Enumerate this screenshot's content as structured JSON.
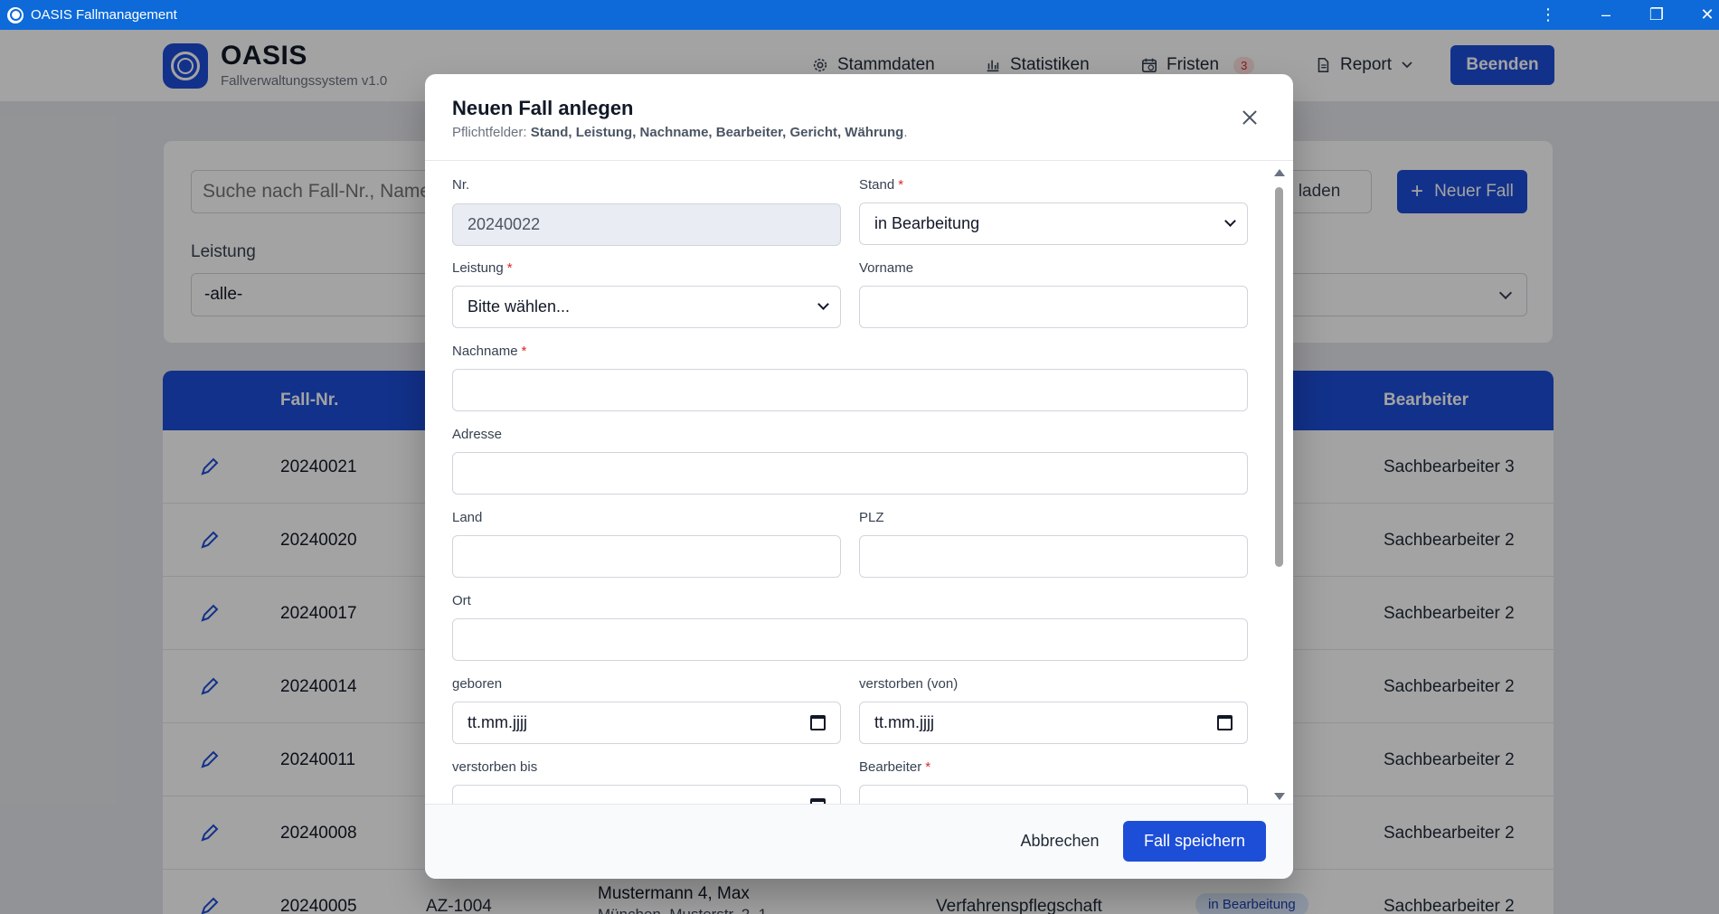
{
  "window": {
    "title": "OASIS Fallmanagement"
  },
  "header": {
    "brand": "OASIS",
    "subtitle": "Fallverwaltungssystem v1.0",
    "nav": {
      "stammdaten": "Stammdaten",
      "statistiken": "Statistiken",
      "fristen": "Fristen",
      "fristen_badge": "3",
      "report": "Report"
    },
    "exit_label": "Beenden"
  },
  "filters": {
    "search_placeholder": "Suche nach Fall-Nr., Name",
    "reload_label": "Neu laden",
    "new_case_label": "Neuer Fall",
    "leistung_label": "Leistung",
    "leistung_value": "-alle-"
  },
  "table": {
    "headers": {
      "nr": "Fall-Nr.",
      "bearbeiter": "Bearbeiter"
    },
    "status_fragment": "g",
    "rows": [
      {
        "nr": "20240021",
        "bearbeiter": "Sachbearbeiter 3"
      },
      {
        "nr": "20240020",
        "bearbeiter": "Sachbearbeiter 2"
      },
      {
        "nr": "20240017",
        "bearbeiter": "Sachbearbeiter 2"
      },
      {
        "nr": "20240014",
        "bearbeiter": "Sachbearbeiter 2"
      },
      {
        "nr": "20240011",
        "bearbeiter": "Sachbearbeiter 2"
      },
      {
        "nr": "20240008",
        "bearbeiter": "Sachbearbeiter 2"
      },
      {
        "nr": "20240005",
        "az": "AZ-1004",
        "name": "Mustermann 4, Max",
        "address": "München, Musterstr. 2, 1",
        "leistung": "Verfahrenspflegschaft",
        "status": "in Bearbeitung",
        "bearbeiter": "Sachbearbeiter 2"
      }
    ]
  },
  "modal": {
    "title": "Neuen Fall anlegen",
    "required_prefix": "Pflichtfelder:",
    "required_fields": "Stand, Leistung, Nachname, Bearbeiter, Gericht, Währung",
    "required_suffix": ".",
    "fields": {
      "nr_label": "Nr.",
      "nr_value": "20240022",
      "stand_label": "Stand",
      "stand_value": "in Bearbeitung",
      "leistung_label": "Leistung",
      "leistung_value": "Bitte wählen...",
      "vorname_label": "Vorname",
      "nachname_label": "Nachname",
      "adresse_label": "Adresse",
      "land_label": "Land",
      "plz_label": "PLZ",
      "ort_label": "Ort",
      "geboren_label": "geboren",
      "geboren_placeholder": "tt.mm.jjjj",
      "verstorben_von_label": "verstorben (von)",
      "verstorben_von_placeholder": "tt.mm.jjjj",
      "verstorben_bis_label": "verstorben bis",
      "bearbeiter_label": "Bearbeiter"
    },
    "required_marker": "*",
    "cancel_label": "Abbrechen",
    "save_label": "Fall speichern"
  },
  "colors": {
    "primary": "#1d4ed8",
    "titlebar": "#0d6ad8",
    "required": "#dc2626"
  }
}
